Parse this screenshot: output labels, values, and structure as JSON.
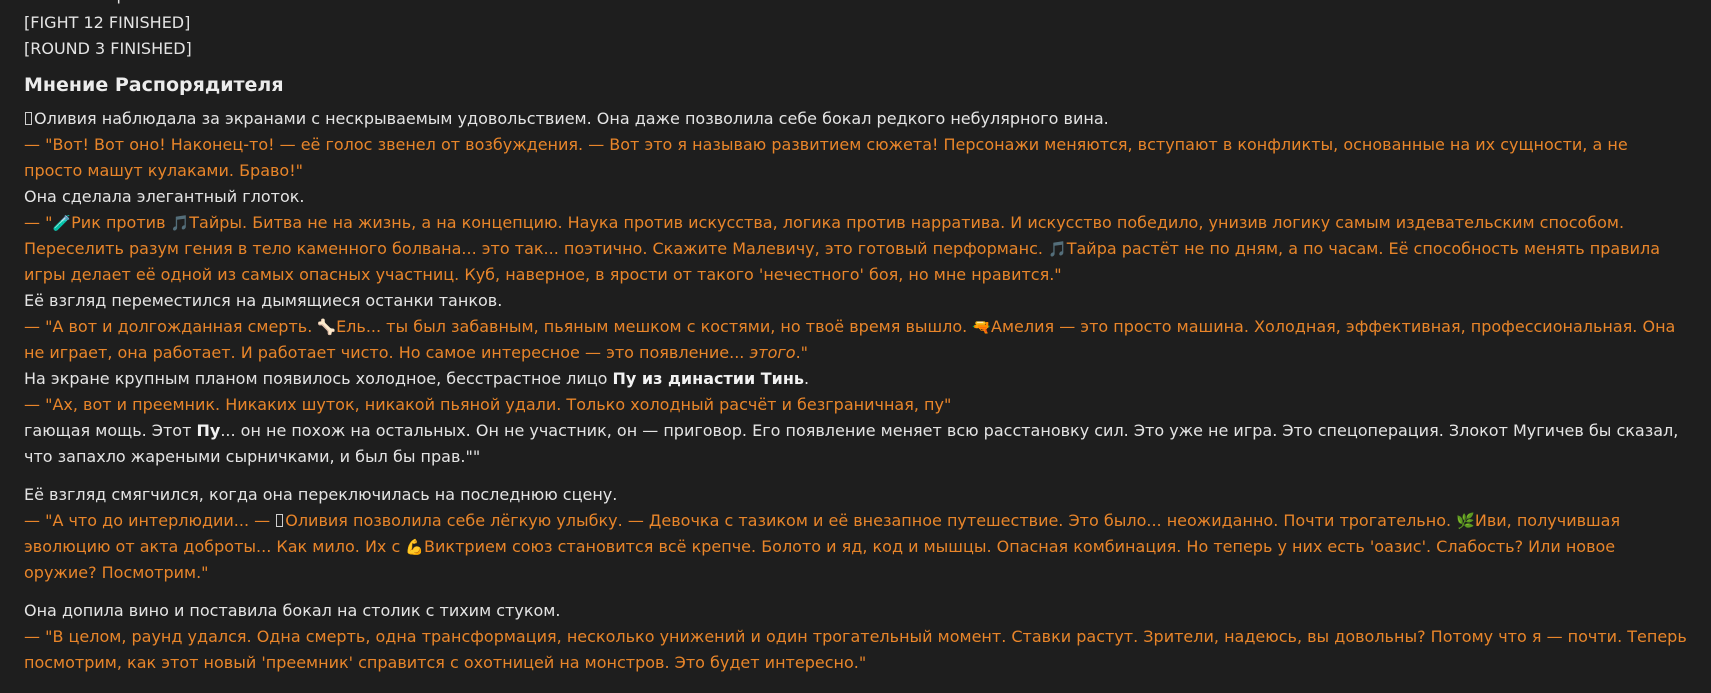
{
  "header": {
    "cut_text": "более совершенной.",
    "tag_fight": "[FIGHT 12 FINISHED]",
    "tag_round": "[ROUND 3 FINISHED]",
    "heading": "Мнение Распорядителя"
  },
  "emojis": {
    "scientist": "🧪",
    "music": "🎵",
    "bone": "🦴",
    "gun": "🔫",
    "leaf": "🌿",
    "muscle": "💪"
  },
  "p1": {
    "narr": "Оливия наблюдала за экранами с нескрываемым удовольствием. Она даже позволила себе бокал редкого небулярного вина.",
    "quote": "— \"Вот! Вот оно! Наконец-то! — её голос звенел от возбуждения. — Вот это я называю развитием сюжета! Персонажи меняются, вступают в конфликты, основанные на их сущности, а не просто машут кулаками. Браво!\""
  },
  "p2": {
    "narr": "Она сделала элегантный глоток.",
    "q_start": "— \"",
    "q_a": "Рик против ",
    "q_b": "Тайры. Битва не на жизнь, а на концепцию. Наука против искусства, логика против нарратива. И искусство победило, унизив логику самым издевательским способом. Переселить разум гения в тело каменного болвана... это так... поэтично. Скажите Малевичу, это готовый перформанс. ",
    "q_c": "Тайра растёт не по дням, а по часам. Её способность менять правила игры делает её одной из самых опасных участниц. Куб, наверное, в ярости от такого 'нечестного' боя, но мне нравится.\""
  },
  "p3": {
    "narr": "Её взгляд переместился на дымящиеся останки танков.",
    "q_start": "— \"А вот и долгожданная смерть. ",
    "q_a": "Ель... ты был забавным, пьяным мешком с костями, но твоё время вышло. ",
    "q_b": "Амелия — это просто машина. Холодная, эффективная, профессиональная. Она не играет, она работает. И работает чисто. Но самое интересное — это появление... ",
    "q_italic": "этого",
    "q_end": ".\""
  },
  "p4": {
    "narr_a": "На экране крупным планом появилось холодное, бесстрастное лицо ",
    "narr_bold": "Пу из династии Тинь",
    "narr_end": ".",
    "quote": "— \"Ах, вот и преемник. Никаких шуток, никакой пьяной удали. Только холодный расчёт и безграничная, пу\"",
    "tail_a": "гающая мощь. Этот ",
    "tail_bold": "Пу",
    "tail_b": "... он не похож на остальных. Он не участник, он — приговор. Его появление меняет всю расстановку сил. Это уже не игра. Это спецоперация. Злокот Мугичев бы сказал, что запахло жареными сырничками, и был бы прав.\"\""
  },
  "p5": {
    "narr": "Её взгляд смягчился, когда она переключилась на последнюю сцену.",
    "q_a": "— \"А что до интерлюдии... — ",
    "q_b": "Оливия позволила себе лёгкую улыбку. — Девочка с тазиком и её внезапное путешествие. Это было... неожиданно. Почти трогательно. ",
    "q_c": "Иви, получившая эволюцию от акта доброты... Как мило. Их с ",
    "q_d": "Виктрием союз становится всё крепче. Болото и яд, код и мышцы. Опасная комбинация. Но теперь у них есть 'оазис'. Слабость? Или новое оружие? Посмотрим.\""
  },
  "p6": {
    "narr": "Она допила вино и поставила бокал на столик с тихим стуком.",
    "quote": "— \"В целом, раунд удался. Одна смерть, одна трансформация, несколько унижений и один трогательный момент. Ставки растут. Зрители, надеюсь, вы довольны? Потому что я — почти. Теперь посмотрим, как этот новый 'преемник' справится с охотницей на монстров. Это будет интересно.\""
  }
}
